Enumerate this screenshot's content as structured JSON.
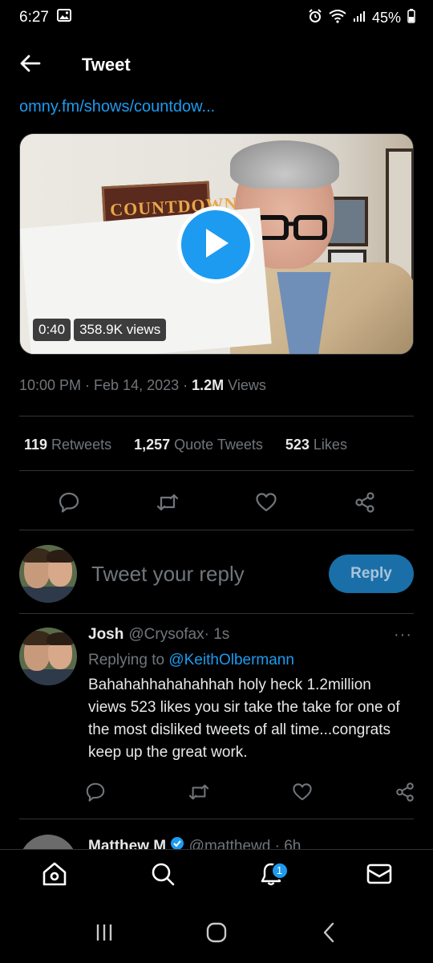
{
  "status_bar": {
    "time": "6:27",
    "battery": "45%",
    "icons": [
      "gallery-icon",
      "alarm-icon",
      "wifi-icon",
      "signal-icon",
      "battery-icon"
    ]
  },
  "header": {
    "title": "Tweet",
    "back_icon": "arrow-left-icon"
  },
  "tweet": {
    "link_text": "omny.fm/shows/countdow...",
    "video": {
      "duration": "0:40",
      "views": "358.9K views",
      "poster_text": "COUNTDOWN"
    },
    "timestamp": "10:00 PM · Feb 14, 2023 · ",
    "view_count": "1.2M",
    "view_label": " Views",
    "stats": {
      "retweets_count": "119",
      "retweets_label": " Retweets",
      "quotes_count": "1,257",
      "quotes_label": " Quote Tweets",
      "likes_count": "523",
      "likes_label": " Likes"
    }
  },
  "composer": {
    "placeholder": "Tweet your reply",
    "button_label": "Reply"
  },
  "reply": {
    "name": "Josh",
    "handle": "@Crysofax",
    "time": " · 1s",
    "more": "···",
    "replying_to_label": "Replying to ",
    "replying_to_handle": "@KeithOlbermann",
    "text": "Bahahahhahahahhah holy heck 1.2million views 523 likes you sir take the take for one of the most disliked tweets of all time...congrats keep up the great work."
  },
  "next_reply": {
    "name": "Matthew M",
    "handle": "@matthewd",
    "time": "· 6h"
  },
  "bottom_nav": {
    "notification_badge": "1",
    "items": [
      "home-icon",
      "search-icon",
      "notifications-icon",
      "messages-icon"
    ]
  },
  "colors": {
    "accent": "#1d9bf0",
    "background": "#000000",
    "muted": "#71767b",
    "text": "#e7e9ea"
  }
}
